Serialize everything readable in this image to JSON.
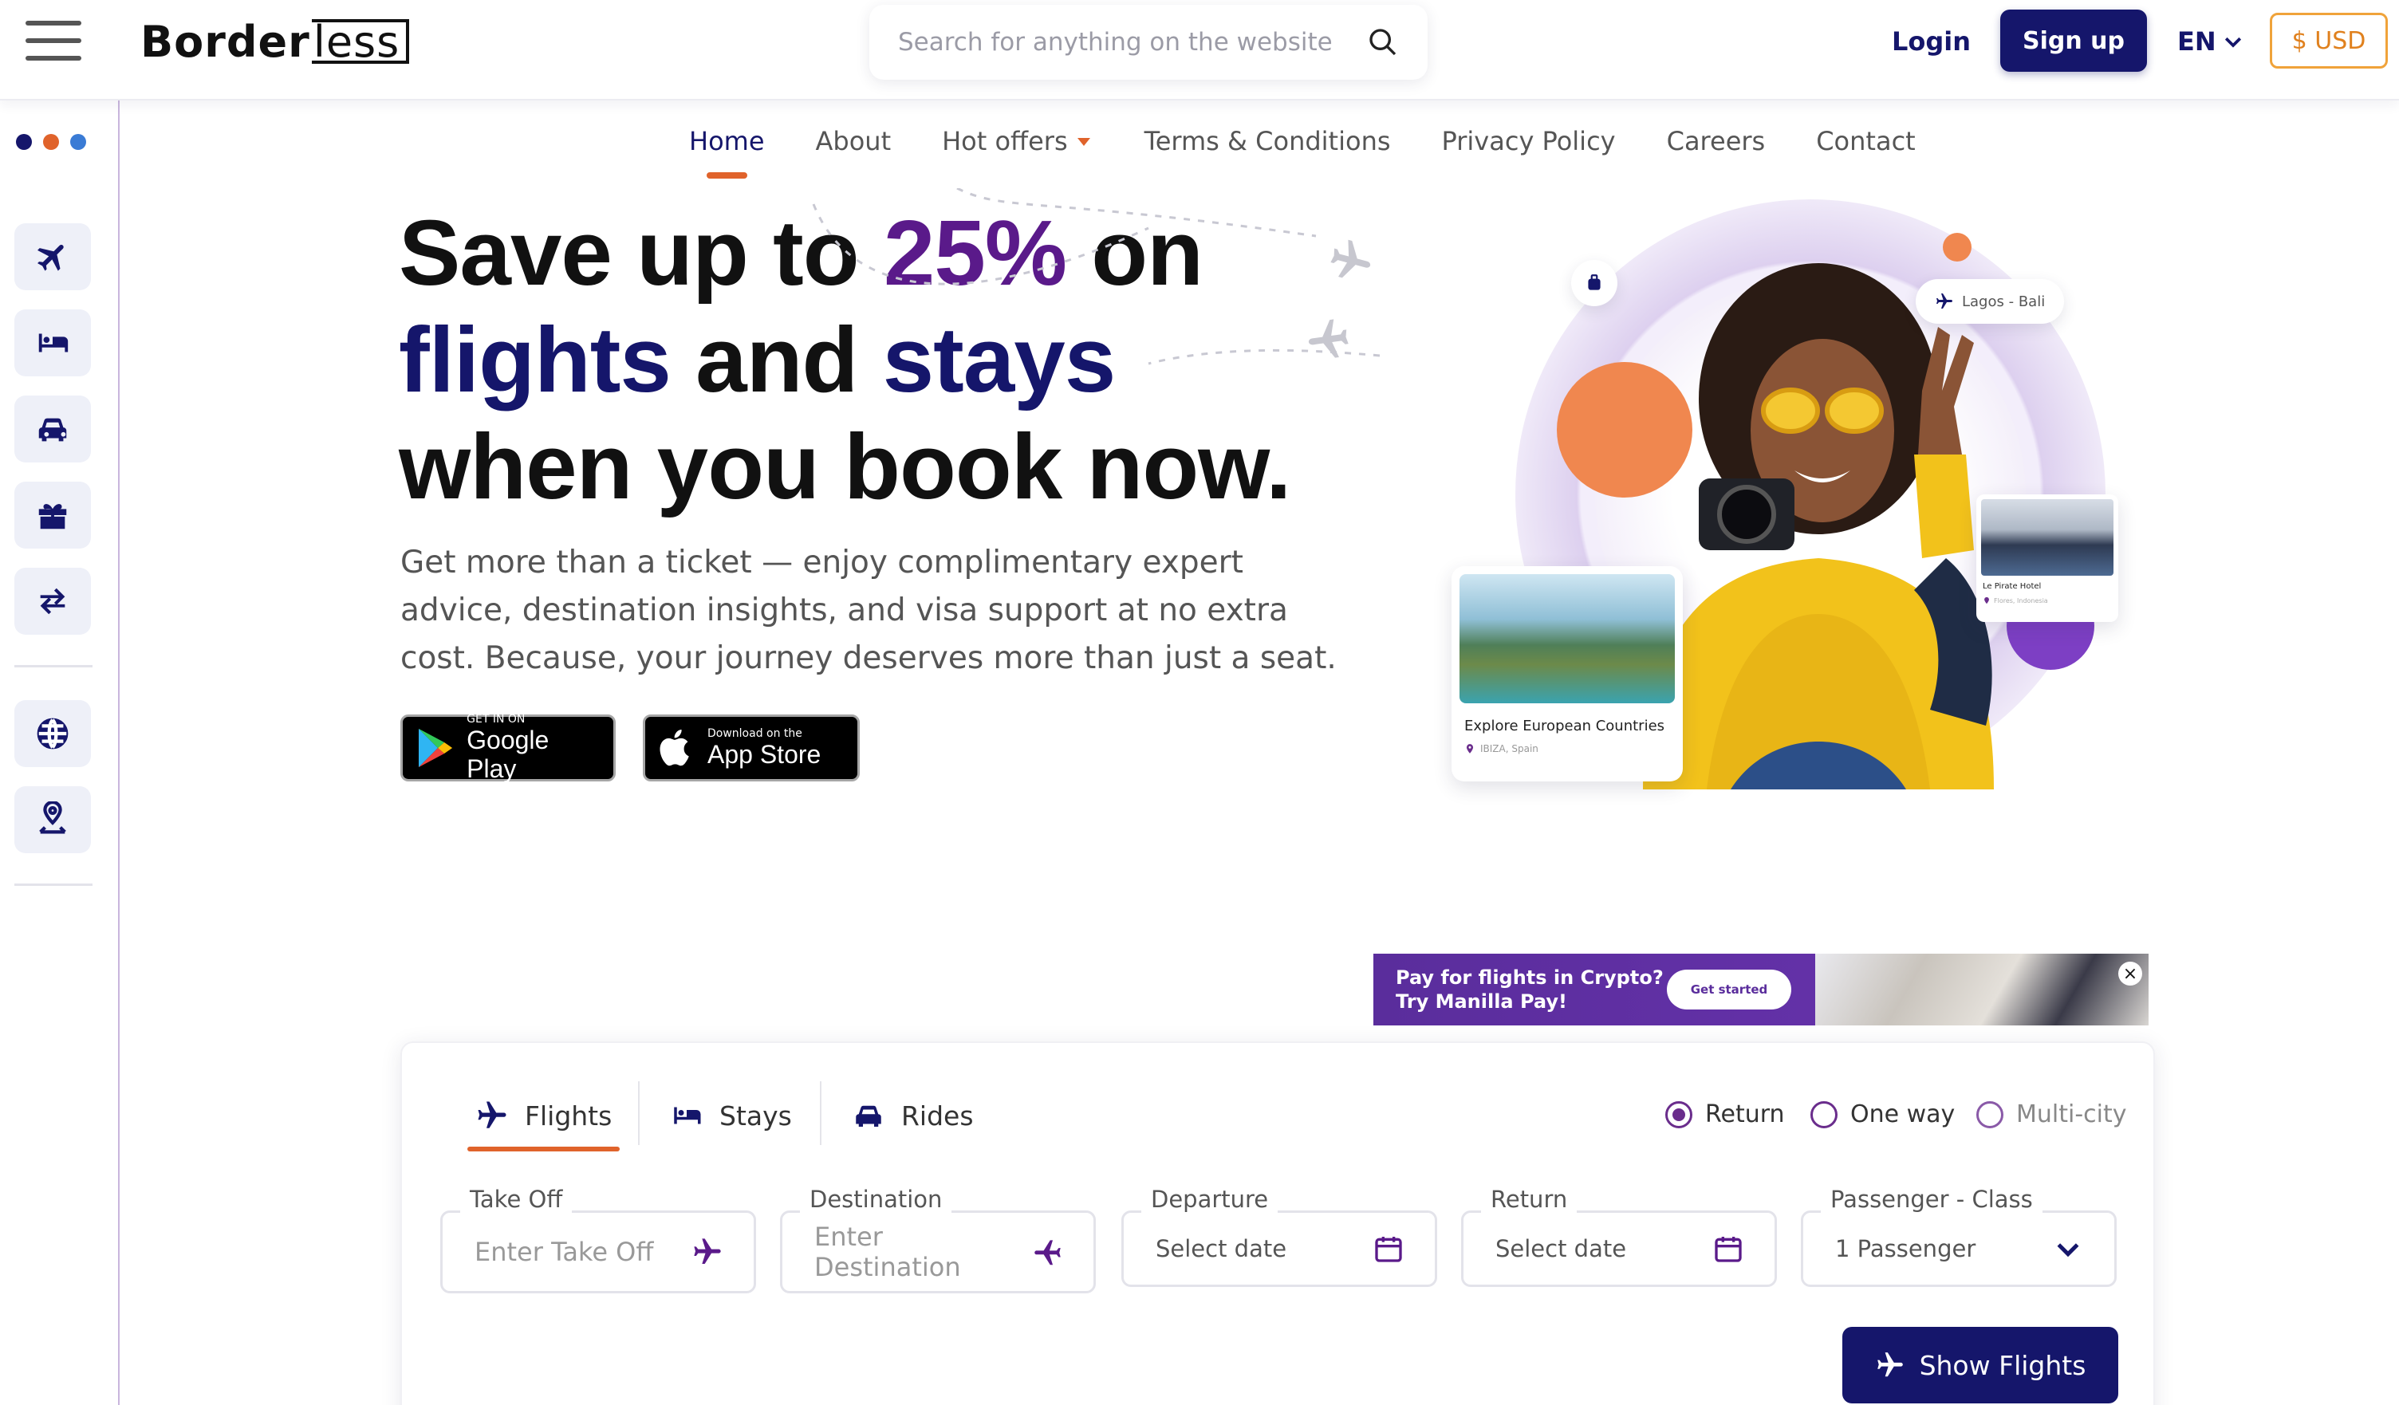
{
  "header": {
    "logo_text_main": "Border",
    "logo_text_tail": "less",
    "search_placeholder": "Search for anything on the website",
    "login": "Login",
    "signup": "Sign up",
    "language": "EN",
    "currency": "$ USD"
  },
  "sidebar": {
    "dot_colors": [
      "#15166b",
      "#e0632b",
      "#3a7bd5"
    ],
    "items": [
      {
        "icon": "plane-icon",
        "name": "sidebar-item-flights"
      },
      {
        "icon": "bed-icon",
        "name": "sidebar-item-stays"
      },
      {
        "icon": "car-icon",
        "name": "sidebar-item-rides"
      },
      {
        "icon": "gift-icon",
        "name": "sidebar-item-gifts"
      },
      {
        "icon": "exchange-icon",
        "name": "sidebar-item-exchange"
      },
      {
        "icon": "globe-icon",
        "name": "sidebar-item-globe"
      },
      {
        "icon": "location-icon",
        "name": "sidebar-item-location"
      }
    ]
  },
  "nav": {
    "items": [
      "Home",
      "About",
      "Hot offers",
      "Terms & Conditions",
      "Privacy Policy",
      "Careers",
      "Contact"
    ],
    "active": "Home"
  },
  "hero": {
    "line1_a": "Save up to ",
    "line1_b": "25%",
    "line1_c": " on",
    "line2_a": "flights",
    "line2_b": " and ",
    "line2_c": "stays",
    "line3": "when you book now.",
    "subtext": "Get more than a ticket — enjoy complimentary expert advice, destination insights, and visa support at no extra cost. Because, your journey deserves more than just a seat.",
    "google_small": "GET IN ON",
    "google_big": "Google Play",
    "apple_small": "Download on the",
    "apple_big": "App Store"
  },
  "collage": {
    "route_pill": "Lagos - Bali",
    "card_main_title": "Explore European Countries",
    "card_main_location": "IBIZA, Spain",
    "card_small_title": "Le Pirate Hotel",
    "card_small_location": "Flores, Indonesia"
  },
  "ad": {
    "line1": "Pay for flights in Crypto?",
    "line2": "Try Manilla Pay!",
    "cta": "Get started"
  },
  "booking": {
    "tabs": [
      "Flights",
      "Stays",
      "Rides"
    ],
    "active_tab": "Flights",
    "trip_types": [
      "Return",
      "One way",
      "Multi-city"
    ],
    "selected_trip": "Return",
    "fields": {
      "takeoff_label": "Take Off",
      "takeoff_placeholder": "Enter Take Off",
      "destination_label": "Destination",
      "destination_placeholder": "Enter Destination",
      "departure_label": "Departure",
      "departure_value": "Select date",
      "return_label": "Return",
      "return_value": "Select date",
      "passenger_label": "Passenger - Class",
      "passenger_value": "1 Passenger"
    },
    "submit": "Show Flights"
  },
  "colors": {
    "navy": "#15166b",
    "accent_orange": "#e0632b",
    "purple": "#5a1a8a"
  }
}
